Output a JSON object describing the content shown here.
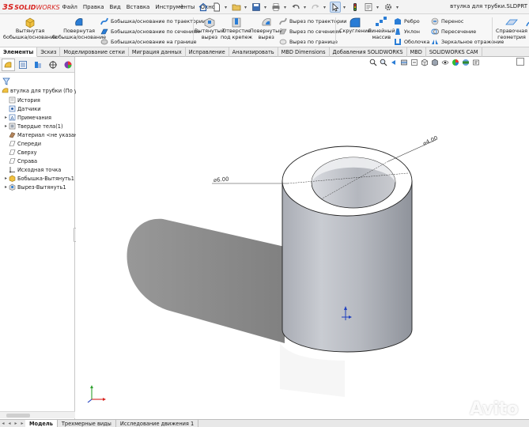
{
  "app": {
    "logo_ds": "3S",
    "logo_solid": "SOLID",
    "logo_works": "WORKS",
    "doc_title": "втулка для трубки.SLDPRT"
  },
  "menu": [
    "Файл",
    "Правка",
    "Вид",
    "Вставка",
    "Инструменты",
    "Окно"
  ],
  "ribbon": {
    "extrude_boss": "Вытянутая бобышка/основание",
    "extrude_boss_l1": "Вытянутая",
    "extrude_boss_l2": "бобышка/основание",
    "revolve_boss_l1": "Повернутая",
    "revolve_boss_l2": "бобышка/основание",
    "sweep_boss": "Бобышка/основание по траектории",
    "loft_boss": "Бобышка/основание по сечениям",
    "boundary_boss": "Бобышка/основание на границе",
    "extrude_cut_l1": "Вытянутый",
    "extrude_cut_l2": "вырез",
    "hole_wizard_l1": "Отверстие",
    "hole_wizard_l2": "под крепеж",
    "revolve_cut_l1": "Повернутый",
    "revolve_cut_l2": "вырез",
    "sweep_cut": "Вырез по траектории",
    "loft_cut": "Вырез по сечениям",
    "boundary_cut": "Вырез по границе",
    "fillet": "Скругление",
    "linear_pattern_l1": "Линейный",
    "linear_pattern_l2": "массив",
    "rib": "Ребро",
    "draft": "Уклон",
    "shell": "Оболочка",
    "wrap": "Перенос",
    "intersect": "Пересечение",
    "mirror": "Зеркальное отражение",
    "ref_geom_l1": "Справочная",
    "ref_geom_l2": "геометрия",
    "curves_l1": "К"
  },
  "command_tabs": [
    {
      "label": "Элементы",
      "active": true
    },
    {
      "label": "Эскиз",
      "active": false
    },
    {
      "label": "Моделирование сетки",
      "active": false
    },
    {
      "label": "Миграция данных",
      "active": false
    },
    {
      "label": "Исправление",
      "active": false
    },
    {
      "label": "Анализировать",
      "active": false
    },
    {
      "label": "MBD Dimensions",
      "active": false
    },
    {
      "label": "Добавления SOLIDWORKS",
      "active": false
    },
    {
      "label": "MBD",
      "active": false
    },
    {
      "label": "SOLIDWORKS CAM",
      "active": false
    }
  ],
  "tree": {
    "root": "втулка для трубки (По умол",
    "items": [
      {
        "label": "История",
        "icon": "history-icon",
        "expander": ""
      },
      {
        "label": "Датчики",
        "icon": "sensor-icon",
        "expander": ""
      },
      {
        "label": "Примечания",
        "icon": "annotations-icon",
        "expander": "▸"
      },
      {
        "label": "Твердые тела(1)",
        "icon": "solid-bodies-icon",
        "expander": "▸"
      },
      {
        "label": "Материал <не указан>",
        "icon": "material-icon",
        "expander": ""
      },
      {
        "label": "Спереди",
        "icon": "plane-icon",
        "expander": ""
      },
      {
        "label": "Сверху",
        "icon": "plane-icon",
        "expander": ""
      },
      {
        "label": "Справа",
        "icon": "plane-icon",
        "expander": ""
      },
      {
        "label": "Исходная точка",
        "icon": "origin-icon",
        "expander": ""
      },
      {
        "label": "Бобышка-Вытянуть1",
        "icon": "boss-extrude-icon",
        "expander": "▸"
      },
      {
        "label": "Вырез-Вытянуть1",
        "icon": "cut-extrude-icon",
        "expander": "▸"
      }
    ]
  },
  "viewport": {
    "dim_outer": "⌀6.00",
    "dim_inner": "⌀4.00"
  },
  "watermark": "Avito",
  "bottom_tabs": [
    {
      "label": "Модель",
      "active": true
    },
    {
      "label": "Трехмерные виды",
      "active": false
    },
    {
      "label": "Исследование движения 1",
      "active": false
    }
  ],
  "colors": {
    "brand_red": "#d8231f",
    "accent_blue": "#1f5fbf",
    "part_gray": "#b9bcc2"
  }
}
